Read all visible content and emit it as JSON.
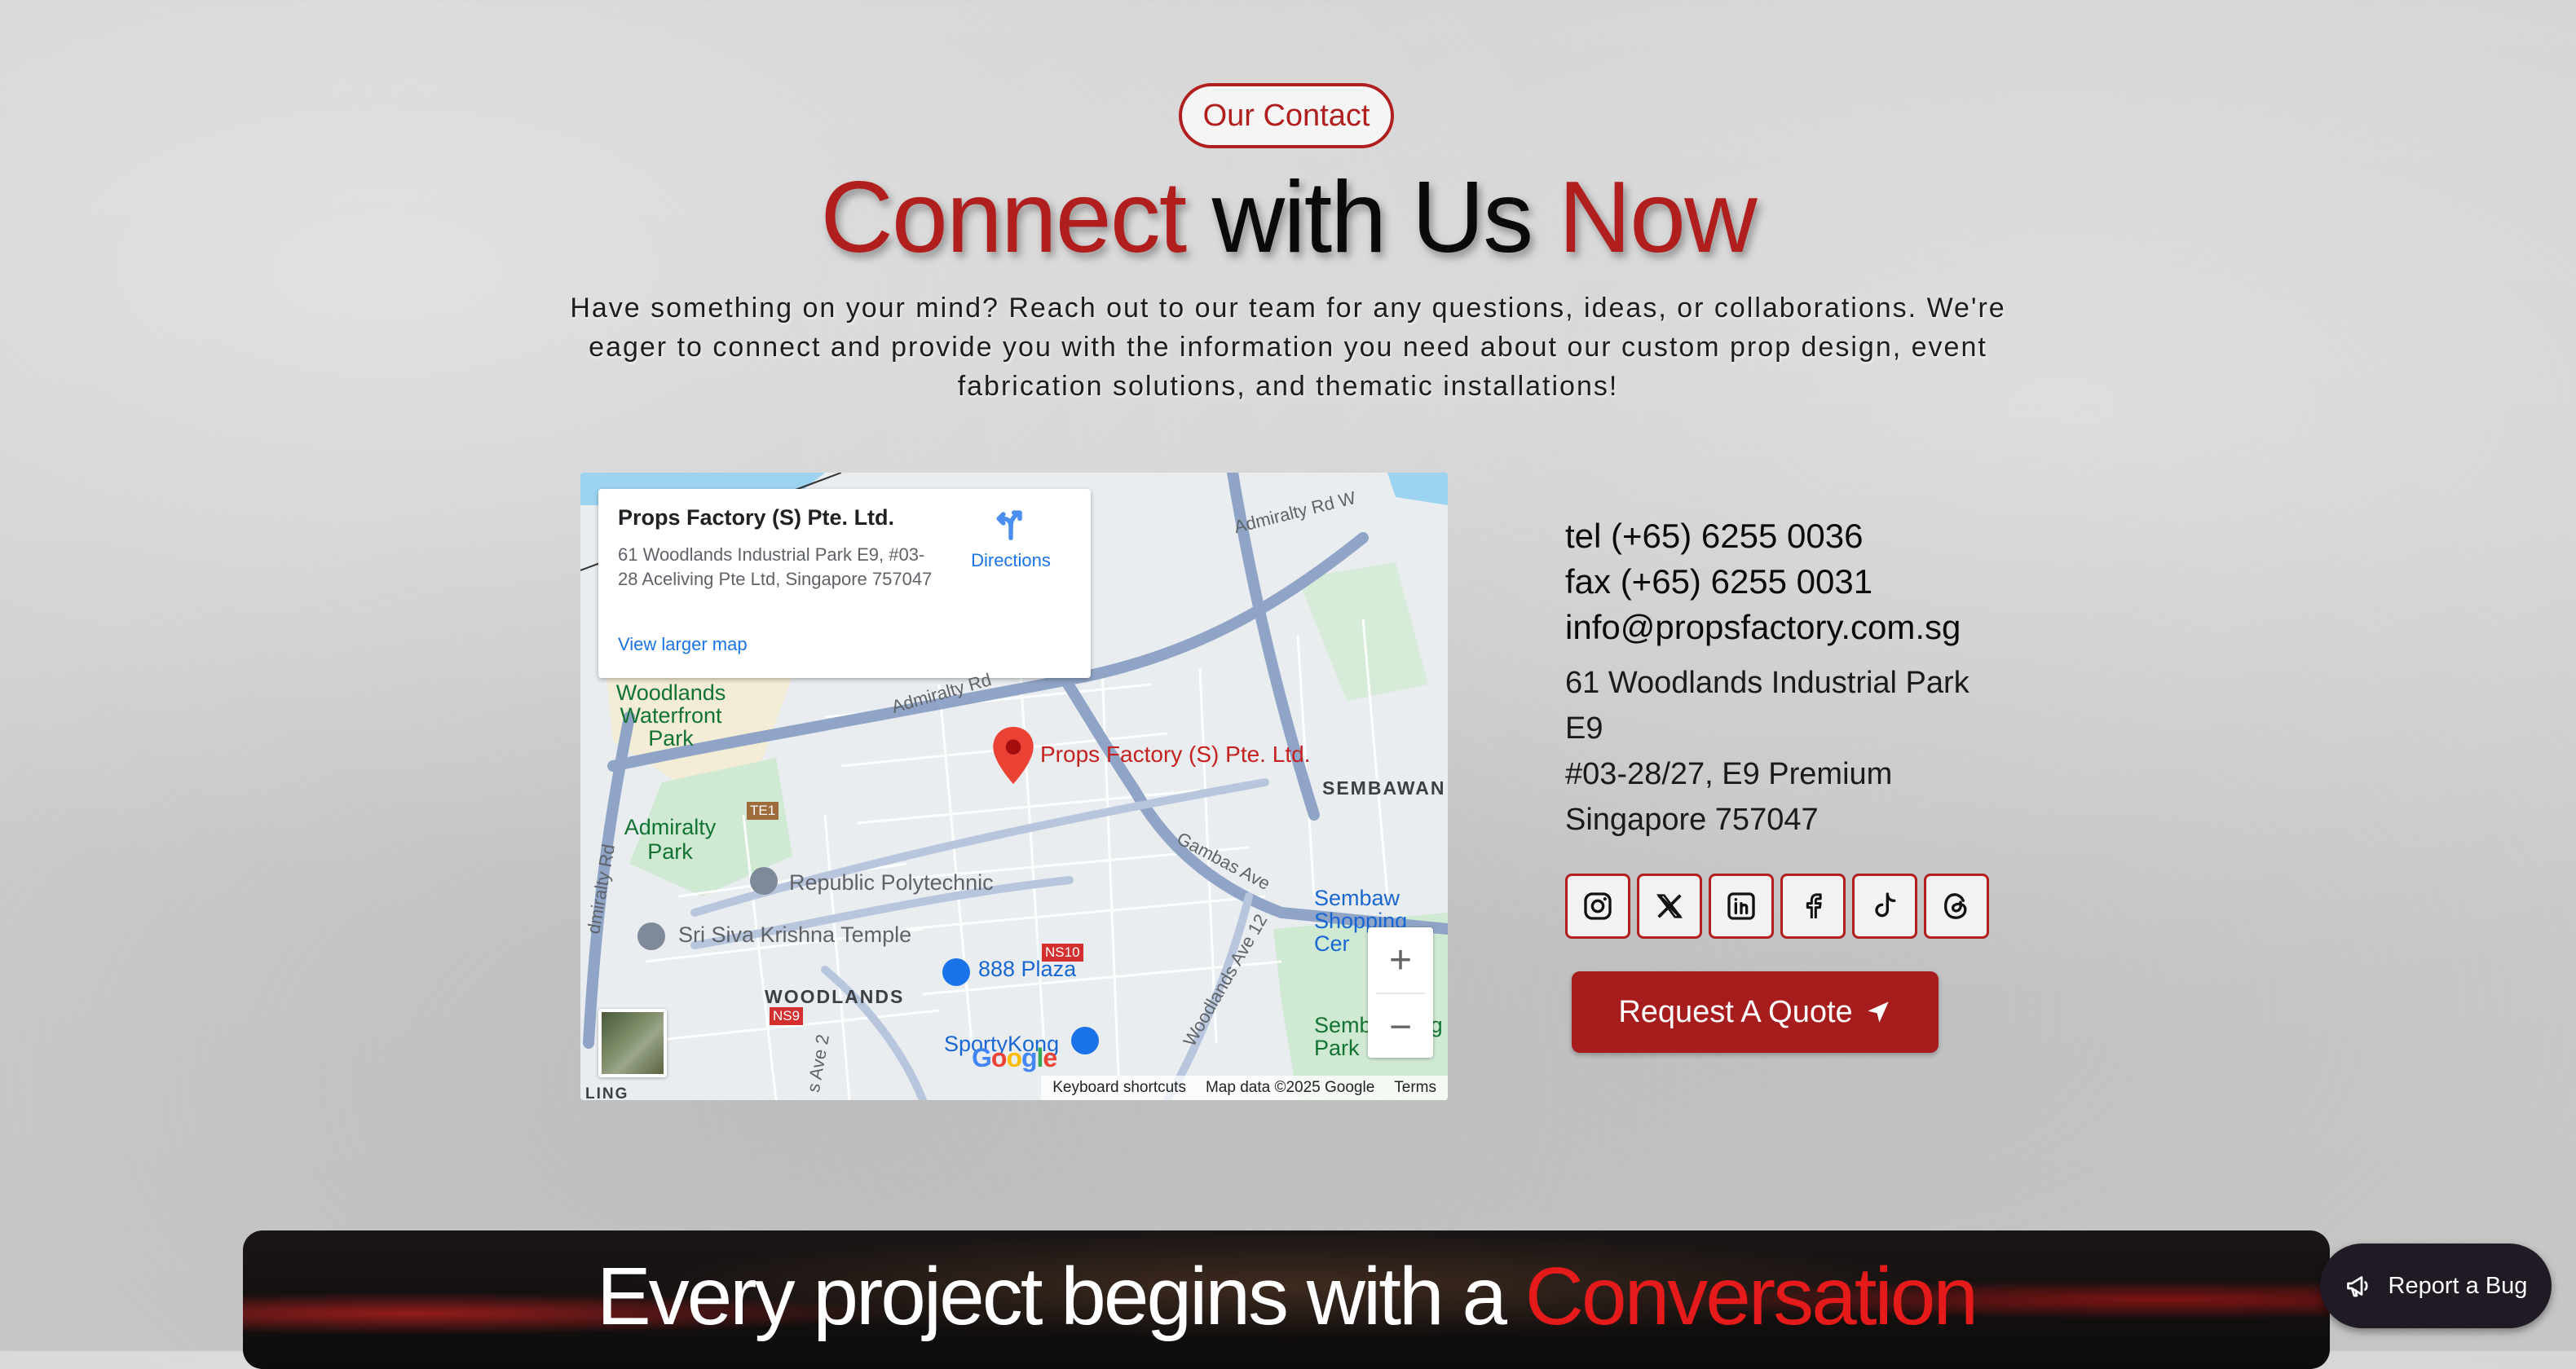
{
  "section": {
    "pill": "Our Contact",
    "headline": {
      "w1": "Connect",
      "w2": "with Us",
      "w3": "Now"
    },
    "intro": "Have something on your mind? Reach out to our team for any questions, ideas, or collaborations. We're eager to connect and provide you with the information you need about our custom prop design, event fabrication solutions, and thematic installations!"
  },
  "map": {
    "card": {
      "name": "Props Factory (S) Pte. Ltd.",
      "address": "61 Woodlands Industrial Park E9, #03-28 Aceliving Pte Ltd, Singapore 757047",
      "directions": "Directions",
      "larger": "View larger map"
    },
    "pin_label": "Props Factory (S) Pte. Ltd.",
    "labels": {
      "woodlands_wf": "Woodlands Waterfront Park",
      "admiralty_park": "Admiralty Park",
      "rp": "Republic Polytechnic",
      "temple": "Sri Siva Krishna Temple",
      "plaza": "888 Plaza",
      "woodlands": "WOODLANDS",
      "sembawang": "SEMBAWAN",
      "sembawang_sc": "Sembaw Shopping Cer",
      "sportykong": "SportyKong",
      "sembawang_park": "Semb    g Ho    g Park",
      "admiralty_rd_w": "Admiralty Rd W",
      "admiralty_rd": "Admiralty Rd",
      "gambas": "Gambas Ave",
      "wave12": "Woodlands Ave 12",
      "ave2": "s Ave 2",
      "admiralty_rd_left": "dmiralty Rd",
      "te1": "TE1",
      "ns10": "NS10",
      "ns9": "NS9",
      "ling": "LING"
    },
    "google": "Google",
    "shortcuts": "Keyboard shortcuts",
    "mapdata": "Map data ©2025 Google",
    "terms": "Terms",
    "zoom_in": "+",
    "zoom_out": "−"
  },
  "contact": {
    "tel": "tel (+65) 6255 0036",
    "fax": "fax (+65) 6255 0031",
    "email": "info@propsfactory.com.sg",
    "address_lines": [
      "61 Woodlands Industrial Park",
      "E9",
      "#03-28/27, E9 Premium",
      "Singapore 757047"
    ]
  },
  "socials": [
    "instagram-icon",
    "x-icon",
    "linkedin-icon",
    "facebook-icon",
    "tiktok-icon",
    "threads-icon"
  ],
  "cta": {
    "quote": "Request A Quote"
  },
  "banner": {
    "part1": "Every project begins with a",
    "part2": "Conversation"
  },
  "bug": {
    "label": "Report a Bug"
  },
  "colors": {
    "accent": "#b01e1e",
    "banner_red": "#e51b1b"
  }
}
